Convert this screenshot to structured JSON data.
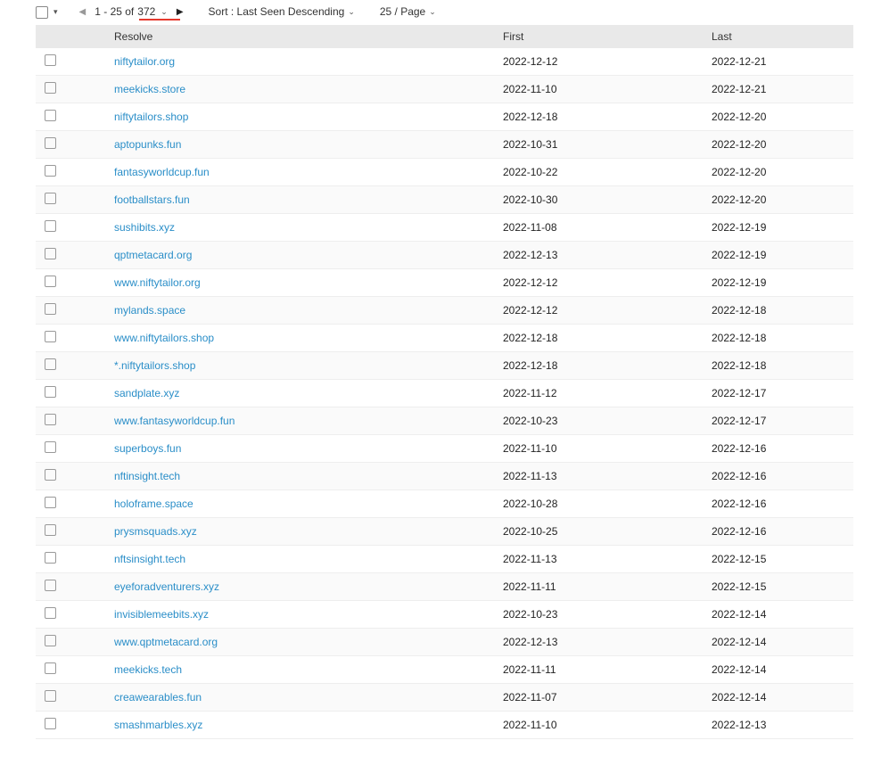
{
  "toolbar": {
    "range_prefix": "1 - 25 of",
    "range_total": "372",
    "sort_label": "Sort : Last Seen Descending",
    "per_page_label": "25 / Page"
  },
  "columns": {
    "resolve": "Resolve",
    "first": "First",
    "last": "Last"
  },
  "rows": [
    {
      "resolve": "niftytailor.org",
      "first": "2022-12-12",
      "last": "2022-12-21"
    },
    {
      "resolve": "meekicks.store",
      "first": "2022-11-10",
      "last": "2022-12-21"
    },
    {
      "resolve": "niftytailors.shop",
      "first": "2022-12-18",
      "last": "2022-12-20"
    },
    {
      "resolve": "aptopunks.fun",
      "first": "2022-10-31",
      "last": "2022-12-20"
    },
    {
      "resolve": "fantasyworldcup.fun",
      "first": "2022-10-22",
      "last": "2022-12-20"
    },
    {
      "resolve": "footballstars.fun",
      "first": "2022-10-30",
      "last": "2022-12-20"
    },
    {
      "resolve": "sushibits.xyz",
      "first": "2022-11-08",
      "last": "2022-12-19"
    },
    {
      "resolve": "qptmetacard.org",
      "first": "2022-12-13",
      "last": "2022-12-19"
    },
    {
      "resolve": "www.niftytailor.org",
      "first": "2022-12-12",
      "last": "2022-12-19"
    },
    {
      "resolve": "mylands.space",
      "first": "2022-12-12",
      "last": "2022-12-18"
    },
    {
      "resolve": "www.niftytailors.shop",
      "first": "2022-12-18",
      "last": "2022-12-18"
    },
    {
      "resolve": "*.niftytailors.shop",
      "first": "2022-12-18",
      "last": "2022-12-18"
    },
    {
      "resolve": "sandplate.xyz",
      "first": "2022-11-12",
      "last": "2022-12-17"
    },
    {
      "resolve": "www.fantasyworldcup.fun",
      "first": "2022-10-23",
      "last": "2022-12-17"
    },
    {
      "resolve": "superboys.fun",
      "first": "2022-11-10",
      "last": "2022-12-16"
    },
    {
      "resolve": "nftinsight.tech",
      "first": "2022-11-13",
      "last": "2022-12-16"
    },
    {
      "resolve": "holoframe.space",
      "first": "2022-10-28",
      "last": "2022-12-16"
    },
    {
      "resolve": "prysmsquads.xyz",
      "first": "2022-10-25",
      "last": "2022-12-16"
    },
    {
      "resolve": "nftsinsight.tech",
      "first": "2022-11-13",
      "last": "2022-12-15"
    },
    {
      "resolve": "eyeforadventurers.xyz",
      "first": "2022-11-11",
      "last": "2022-12-15"
    },
    {
      "resolve": "invisiblemeebits.xyz",
      "first": "2022-10-23",
      "last": "2022-12-14"
    },
    {
      "resolve": "www.qptmetacard.org",
      "first": "2022-12-13",
      "last": "2022-12-14"
    },
    {
      "resolve": "meekicks.tech",
      "first": "2022-11-11",
      "last": "2022-12-14"
    },
    {
      "resolve": "creawearables.fun",
      "first": "2022-11-07",
      "last": "2022-12-14"
    },
    {
      "resolve": "smashmarbles.xyz",
      "first": "2022-11-10",
      "last": "2022-12-13"
    }
  ]
}
